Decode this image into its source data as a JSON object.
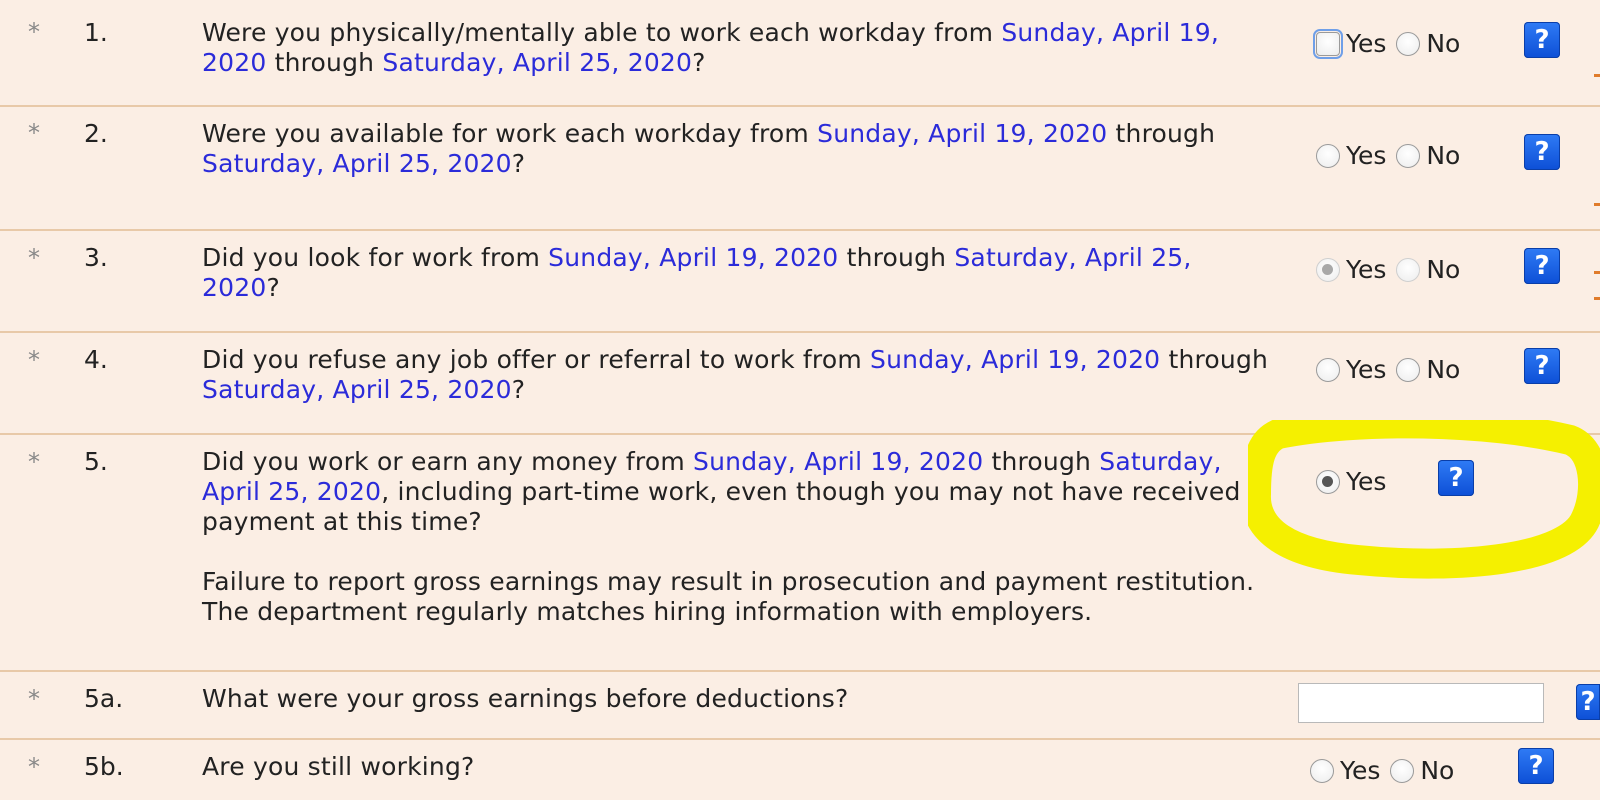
{
  "questions": [
    {
      "number": "1.",
      "text_parts": [
        "Were you physically/mentally able to work each workday from ",
        "Sunday, April 19, 2020",
        " through ",
        "Saturday, April 25, 2020",
        "?"
      ],
      "options": [
        {
          "label": "Yes",
          "selected": false
        },
        {
          "label": "No",
          "selected": false
        }
      ]
    },
    {
      "number": "2.",
      "text_parts": [
        "Were you available for work each workday from ",
        "Sunday, April 19, 2020",
        " through ",
        "Saturday, April 25, 2020",
        "?"
      ],
      "options": [
        {
          "label": "Yes",
          "selected": false
        },
        {
          "label": "No",
          "selected": false
        }
      ]
    },
    {
      "number": "3.",
      "text_parts": [
        "Did you look for work from ",
        "Sunday, April 19, 2020",
        " through ",
        "Saturday, April 25, 2020",
        "?"
      ],
      "options": [
        {
          "label": "Yes",
          "selected": true
        },
        {
          "label": "No",
          "selected": false
        }
      ]
    },
    {
      "number": "4.",
      "text_parts": [
        "Did you refuse any job offer or referral to work from ",
        "Sunday, April 19, 2020",
        " through ",
        "Saturday, April 25, 2020",
        "?"
      ],
      "options": [
        {
          "label": "Yes",
          "selected": false
        },
        {
          "label": "No",
          "selected": false
        }
      ]
    },
    {
      "number": "5.",
      "text_parts": [
        "Did you work or earn any money from ",
        "Sunday, April 19, 2020",
        " through ",
        "Saturday, April 25, 2020",
        ", including part-time work, even though you may not have received payment at this time?"
      ],
      "notice_1": "Failure to report gross earnings may result in prosecution and payment restitution.",
      "notice_2": "The department regularly matches hiring information with employers.",
      "options": [
        {
          "label": "Yes",
          "selected": true
        }
      ]
    },
    {
      "number": "5a.",
      "text": "What were your gross earnings before deductions?",
      "input_value": ""
    },
    {
      "number": "5b.",
      "text": "Are you still working?",
      "options": [
        {
          "label": "Yes",
          "selected": false
        },
        {
          "label": "No",
          "selected": false
        }
      ]
    }
  ],
  "help_glyph": "?",
  "required_glyph": "*",
  "icons": {
    "required": "asterisk-icon",
    "help": "help-icon"
  },
  "colors": {
    "background": "#fbeee4",
    "date_text": "#2b2bd9",
    "row_border": "#e8c9a8",
    "help_button": "#1a5fe6",
    "highlight": "#f5f000"
  }
}
